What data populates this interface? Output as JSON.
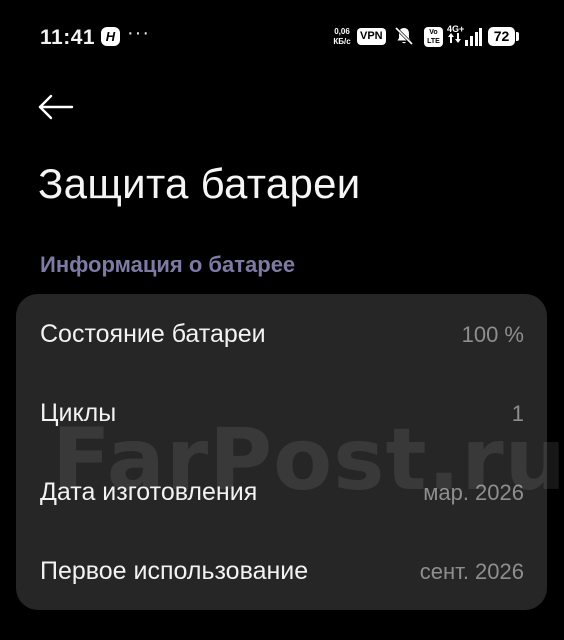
{
  "status_bar": {
    "time": "11:41",
    "app_icon_letter": "H",
    "more": "···",
    "net_speed_value": "0,06",
    "net_speed_unit": "КБ/с",
    "vpn": "VPN",
    "volte_top": "Vo",
    "volte_bottom": "LTE",
    "network_type": "4G+",
    "battery_level": "72",
    "icons": [
      "mute-bell-icon",
      "signal-icon",
      "battery-icon"
    ]
  },
  "header": {
    "title": "Защита батареи"
  },
  "section": {
    "title": "Информация о батарее"
  },
  "battery_info": [
    {
      "label": "Состояние батареи",
      "value": "100 %"
    },
    {
      "label": "Циклы",
      "value": "1"
    },
    {
      "label": "Дата изготовления",
      "value": "мар. 2026"
    },
    {
      "label": "Первое использование",
      "value": "сент. 2026"
    }
  ],
  "watermark": "FarPost.ru",
  "colors": {
    "background": "#000000",
    "card": "#262626",
    "section_accent": "#7d7aa3",
    "secondary_text": "#8e8e8e"
  }
}
